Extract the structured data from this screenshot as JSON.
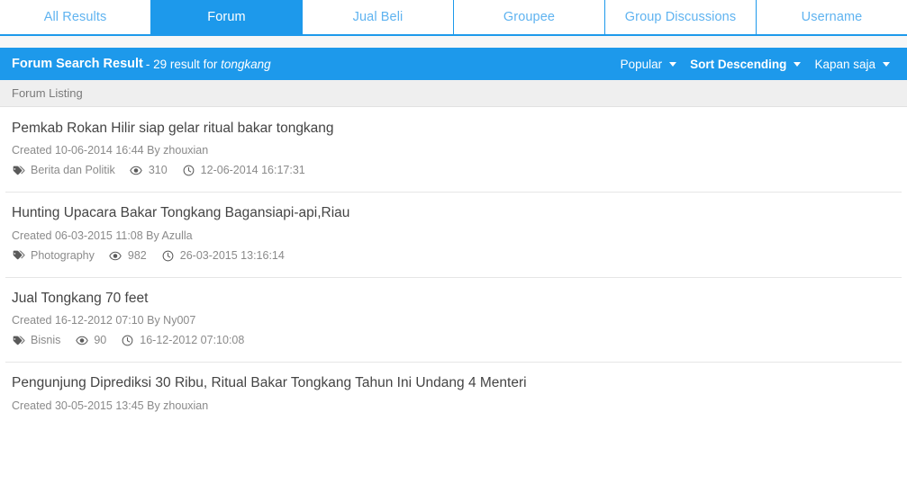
{
  "tabs": [
    {
      "label": "All Results",
      "active": false
    },
    {
      "label": "Forum",
      "active": true
    },
    {
      "label": "Jual Beli",
      "active": false
    },
    {
      "label": "Groupee",
      "active": false
    },
    {
      "label": "Group Discussions",
      "active": false
    },
    {
      "label": "Username",
      "active": false
    }
  ],
  "result_header": {
    "title": "Forum Search Result",
    "separator": " - ",
    "count_text": "29 result for ",
    "search_term": "tongkang",
    "controls": [
      {
        "label": "Popular",
        "bold": false,
        "icon": "chevron-down-icon"
      },
      {
        "label": "Sort Descending",
        "bold": true,
        "icon": "chevron-down-icon"
      },
      {
        "label": "Kapan saja",
        "bold": false,
        "icon": "chevron-down-icon"
      }
    ]
  },
  "listing_bar": {
    "label": "Forum Listing"
  },
  "results": [
    {
      "title": "Pemkab Rokan Hilir siap gelar ritual bakar tongkang",
      "created": "Created 10-06-2014 16:44 By zhouxian",
      "category": "Berita dan Politik",
      "views": "310",
      "updated": "12-06-2014 16:17:31"
    },
    {
      "title": "Hunting Upacara Bakar Tongkang Bagansiapi-api,Riau",
      "created": "Created 06-03-2015 11:08 By Azulla",
      "category": "Photography",
      "views": "982",
      "updated": "26-03-2015 13:16:14"
    },
    {
      "title": "Jual Tongkang 70 feet",
      "created": "Created 16-12-2012 07:10 By Ny007",
      "category": "Bisnis",
      "views": "90",
      "updated": "16-12-2012 07:10:08"
    },
    {
      "title": "Pengunjung Diprediksi 30 Ribu, Ritual Bakar Tongkang Tahun Ini Undang 4 Menteri",
      "created": "Created 30-05-2015 13:45 By zhouxian",
      "category": "",
      "views": "",
      "updated": ""
    }
  ],
  "icons": {
    "tag": "tags-icon",
    "views": "eye-icon",
    "time": "clock-icon",
    "caret": "chevron-down-icon"
  },
  "colors": {
    "accent": "#1d99eb",
    "tab_text": "#5fb3f0",
    "listing_bar_bg": "#efefef",
    "title_text": "#444444",
    "meta_text": "#8a8a8a"
  }
}
